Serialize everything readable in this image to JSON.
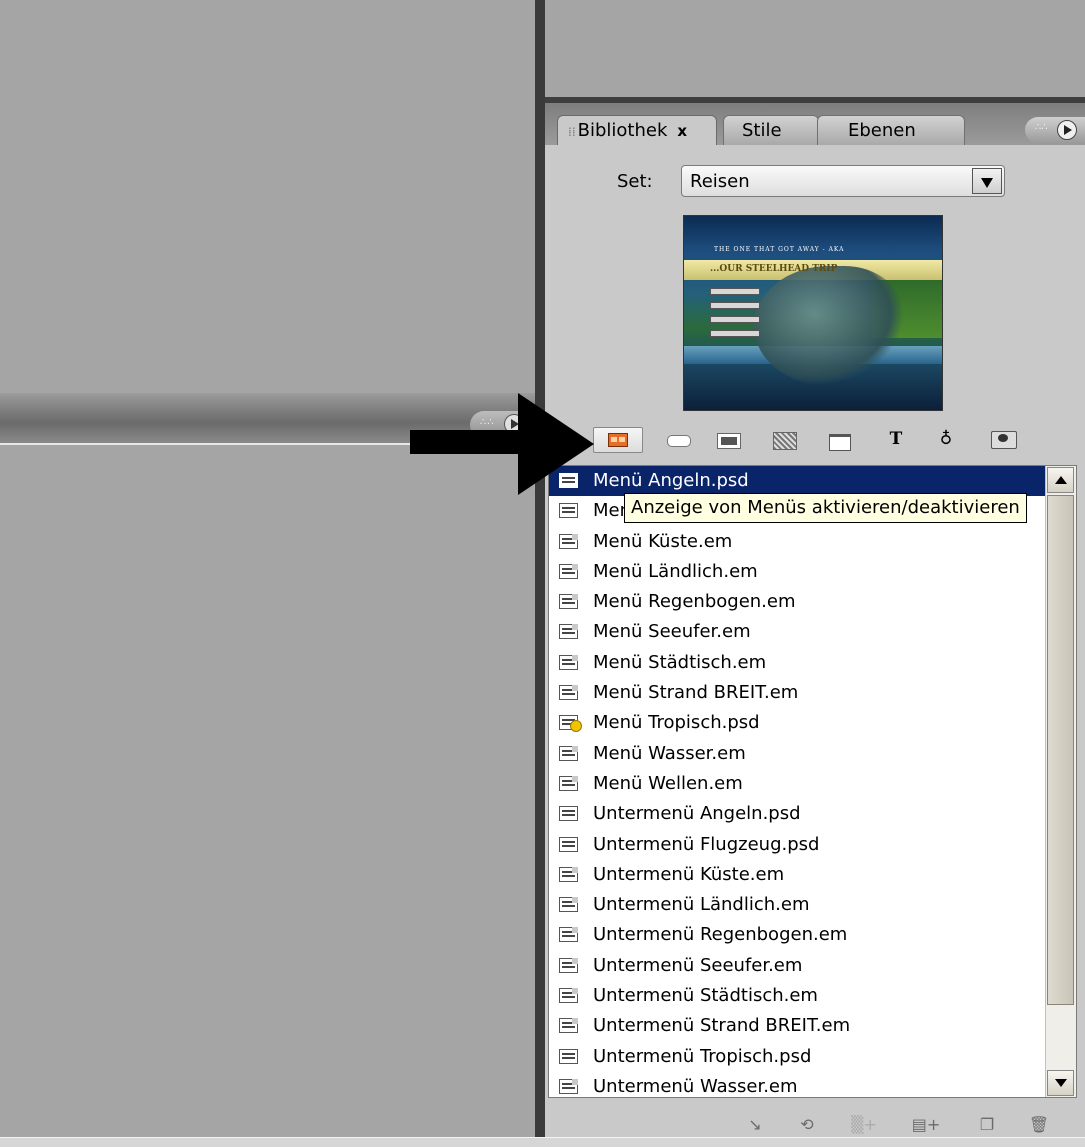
{
  "panel": {
    "tabs": [
      {
        "label": "Bibliothek",
        "close": "x"
      },
      {
        "label": "Stile"
      },
      {
        "label": "Ebenen"
      }
    ],
    "set_label": "Set:",
    "set_value": "Reisen"
  },
  "thumbnail": {
    "line1": "THE ONE THAT GOT AWAY - AKA",
    "line2": "...OUR STEELHEAD TRIP"
  },
  "filter_toolbar": {
    "icons": [
      "menus-icon",
      "buttons-icon",
      "images-icon",
      "backgrounds-icon",
      "folders-icon",
      "text-icon",
      "effects-icon",
      "favorites-icon"
    ],
    "text_glyph": "T",
    "effects_glyph": "♁"
  },
  "tooltip": "Anzeige von Menüs aktivieren/deaktivieren",
  "list": {
    "items": [
      "Menü Angeln.psd",
      "Menü Flugzeug.psd",
      "Menü Küste.em",
      "Menü Ländlich.em",
      "Menü Regenbogen.em",
      "Menü Seeufer.em",
      "Menü Städtisch.em",
      "Menü Strand BREIT.em",
      "Menü Tropisch.psd",
      "Menü Wasser.em",
      "Menü Wellen.em",
      "Untermenü Angeln.psd",
      "Untermenü Flugzeug.psd",
      "Untermenü Küste.em",
      "Untermenü Ländlich.em",
      "Untermenü Regenbogen.em",
      "Untermenü Seeufer.em",
      "Untermenü Städtisch.em",
      "Untermenü Strand BREIT.em",
      "Untermenü Tropisch.psd",
      "Untermenü Wasser.em"
    ],
    "selected_index": 0
  },
  "bottom_toolbar": {
    "link": "↘",
    "unlink": "⟲",
    "new_background": "▒+",
    "new_menu": "▤+",
    "new_item": "❐",
    "delete": "🗑"
  },
  "colors": {
    "selection": "#0a246a",
    "tooltip_bg": "#ffffe1",
    "menus_filter_icon": "#e56f2a"
  }
}
